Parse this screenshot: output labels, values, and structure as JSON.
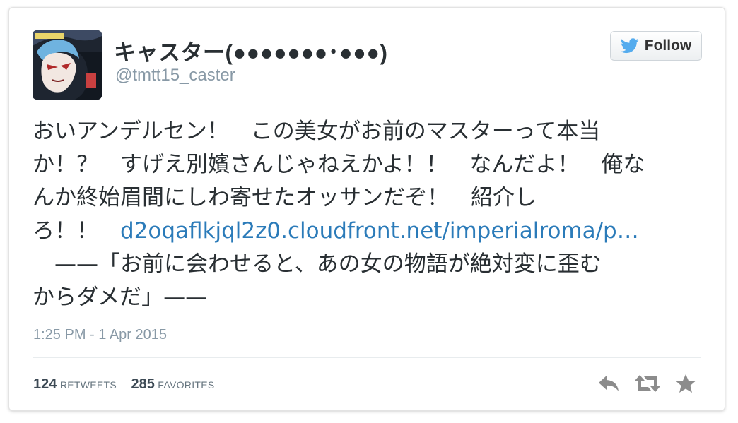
{
  "user": {
    "display_name": "キャスター(●●●●●●●･●●●)",
    "handle": "@tmtt15_caster",
    "avatar_icon": "character-avatar-icon"
  },
  "follow_button": {
    "label": "Follow",
    "icon": "twitter-bird-icon"
  },
  "tweet": {
    "line1": "おいアンデルセン！　この美女がお前のマスターって本当",
    "line2": "か！？　すげえ別嬪さんじゃねえかよ！！　なんだよ！　俺な",
    "line3": "んか終始眉間にしわ寄せたオッサンだぞ！　紹介し",
    "line4_prefix": "ろ！！　",
    "link": "d2oqaflkjql2z0.cloudfront.net/imperialroma/p…",
    "line5": "　——「お前に会わせると、あの女の物語が絶対変に歪む",
    "line6": "からダメだ」——"
  },
  "timestamp": "1:25 PM - 1 Apr 2015",
  "stats": {
    "retweets_count": "124",
    "retweets_label": "RETWEETS",
    "favorites_count": "285",
    "favorites_label": "FAVORITES"
  },
  "actions": {
    "reply_icon": "reply-icon",
    "retweet_icon": "retweet-icon",
    "favorite_icon": "star-icon"
  },
  "colors": {
    "link": "#2b7bb9",
    "bird": "#55acee",
    "muted": "#8899a6",
    "action_icon": "#8c8c8c"
  }
}
